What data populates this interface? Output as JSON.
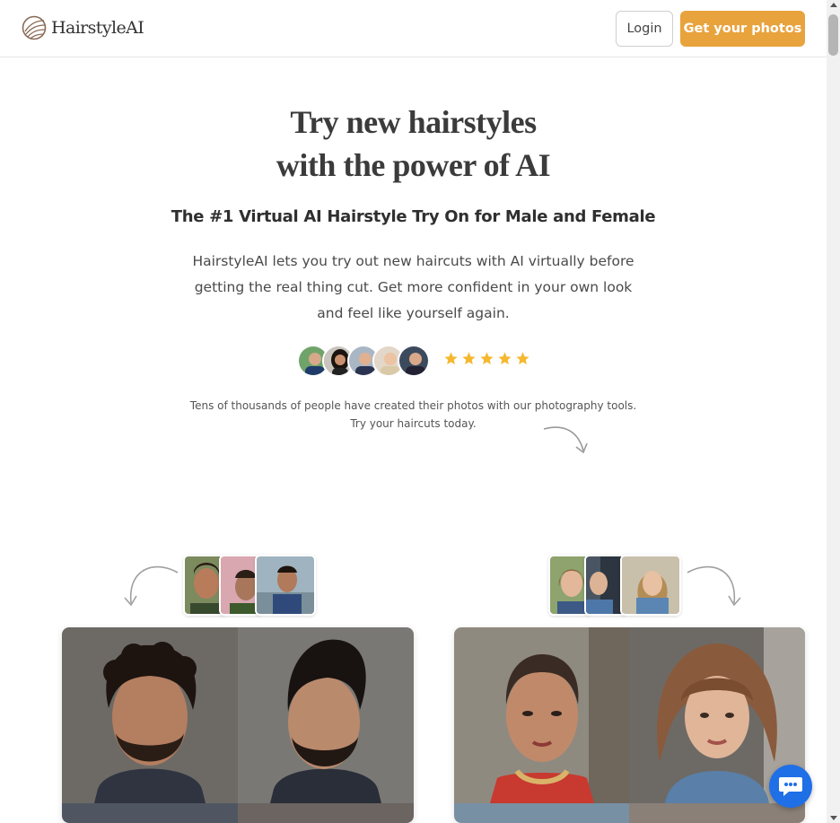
{
  "header": {
    "brand": "HairstyleAI",
    "login_label": "Login",
    "cta_label": "Get your photos"
  },
  "hero": {
    "title_line1": "Try new hairstyles",
    "title_line2": "with the power of AI",
    "subtitle": "The #1 Virtual AI Hairstyle Try On for Male and Female",
    "description": "HairstyleAI lets you try out new haircuts with AI virtually before getting the real thing cut. Get more confident in your own look and feel like yourself again.",
    "rating_stars": 5,
    "social_proof": "Tens of thousands of people have created their photos with our photography tools. Try your haircuts today."
  },
  "colors": {
    "accent": "#e8a33d",
    "star": "#f5b82e",
    "chat": "#1f6fe6",
    "peach": "#fde8d8"
  },
  "icons": {
    "logo": "leaf-logo-icon",
    "star": "star-icon",
    "arrow": "curved-arrow-icon",
    "chat": "chat-bubble-icon"
  }
}
